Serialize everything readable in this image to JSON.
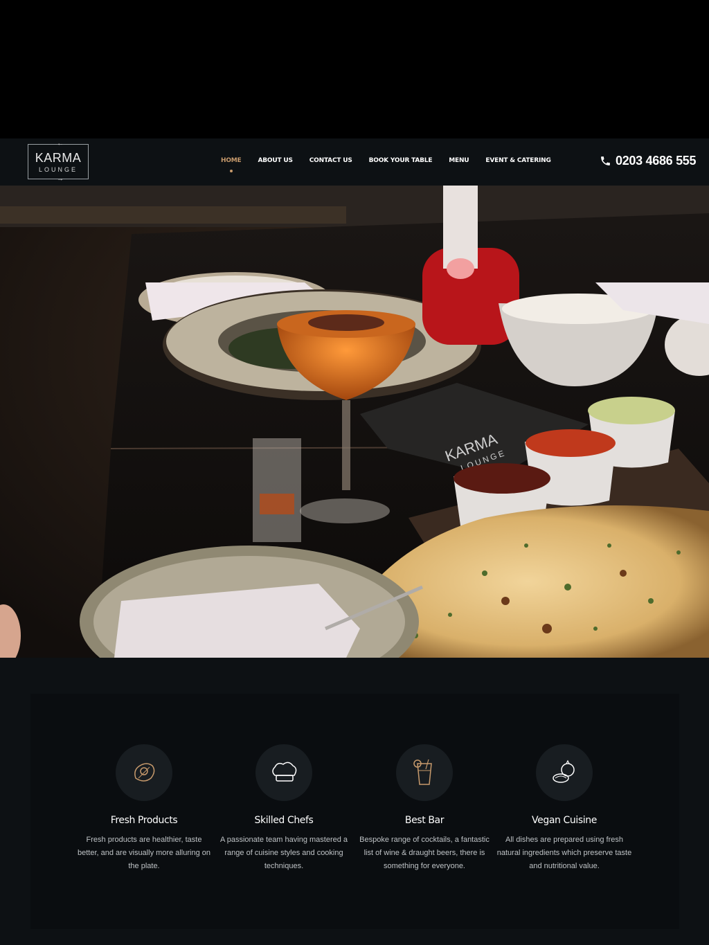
{
  "header": {
    "logo": {
      "line1": "KARMA",
      "line2": "LOUNGE"
    },
    "nav": [
      {
        "label": "HOME",
        "active": true
      },
      {
        "label": "ABOUT US",
        "active": false
      },
      {
        "label": "CONTACT US",
        "active": false
      },
      {
        "label": "BOOK YOUR TABLE",
        "active": false
      },
      {
        "label": "MENU",
        "active": false
      },
      {
        "label": "EVENT & CATERING",
        "active": false
      }
    ],
    "phone": {
      "icon": "phone-icon",
      "number": "0203 4686 555"
    }
  },
  "hero": {
    "image": "restaurant-table-photo",
    "menu_card_text": {
      "line1": "KARMA",
      "line2": "LOUNGE"
    }
  },
  "features": [
    {
      "icon": "meat-icon",
      "title": "Fresh Products",
      "description": "Fresh products are healthier, taste better, and are visually more alluring on the plate."
    },
    {
      "icon": "chef-hat-icon",
      "title": "Skilled Chefs",
      "description": "A passionate team having mastered a range of cuisine styles and cooking techniques."
    },
    {
      "icon": "cocktail-glass-icon",
      "title": "Best Bar",
      "description": "Bespoke range of cocktails, a fantastic list of wine & draught beers, there is something for everyone."
    },
    {
      "icon": "vegetables-icon",
      "title": "Vegan Cuisine",
      "description": "All dishes are prepared using fresh natural ingredients which preserve taste and nutritional value."
    }
  ],
  "colors": {
    "accent": "#c79a6c",
    "background": "#0d1114",
    "panel": "#0a0d10"
  }
}
